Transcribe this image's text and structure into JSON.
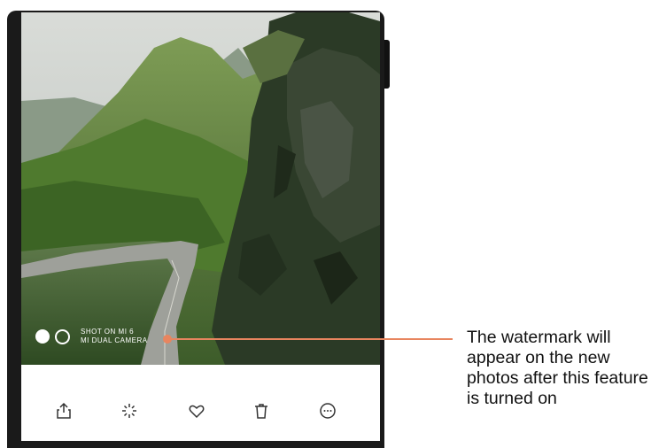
{
  "photo": {
    "description_icon": "landscape-photo"
  },
  "watermark": {
    "line1": "SHOT ON MI 6",
    "line2": "MI DUAL CAMERA"
  },
  "toolbar": {
    "items": [
      {
        "icon": "share-icon"
      },
      {
        "icon": "magic-edit-icon"
      },
      {
        "icon": "heart-icon"
      },
      {
        "icon": "trash-icon"
      },
      {
        "icon": "more-icon"
      }
    ]
  },
  "callout": {
    "text": "The watermark will appear on the new photos after this feature is turned on",
    "color": "#e8855f"
  }
}
